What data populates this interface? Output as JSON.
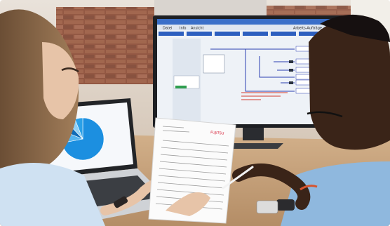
{
  "scene": {
    "description_kind": "office-photo",
    "monitor": {
      "menu": [
        "Datei",
        "Info",
        "Ansicht"
      ],
      "status_text": "Arbeits-Aufträge",
      "highlight_note_lines": 3
    },
    "laptop": {
      "pie_chart": {
        "slices": [
          0.72,
          0.09,
          0.07,
          0.06,
          0.06
        ],
        "colors": [
          "#1c8fe0",
          "#54b4ef",
          "#0f6cb8",
          "#8fd0f6",
          "#2aa0e8"
        ]
      }
    },
    "document": {
      "brand_mark": "FUJITSU",
      "brand_color": "#d4162e"
    },
    "colors": {
      "brick": "#8a4a34",
      "wall_light": "#e7ddd2",
      "desk": "#c7a27c",
      "woman_hair": "#8b6a4a",
      "man_skin": "#3a2418",
      "man_shirt": "#8fb8de"
    }
  }
}
